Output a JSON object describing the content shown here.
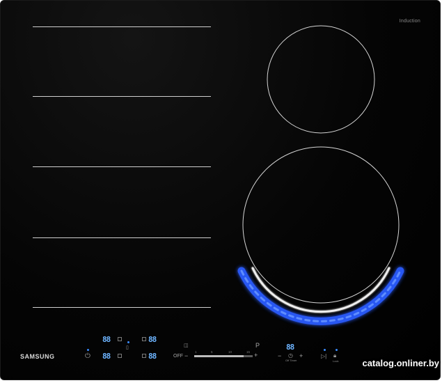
{
  "brand_tag": "Induction",
  "logo": "SAMSUNG",
  "zones": {
    "left_lines": 5
  },
  "displays": {
    "zone_a": "88",
    "zone_b": "88",
    "zone_c": "88",
    "zone_d": "88",
    "timer": "88"
  },
  "controls": {
    "off_label": "OFF",
    "minus_label": "−",
    "plus_label": "+",
    "power_label": "P",
    "timer_minus": "−",
    "timer_plus": "+",
    "timer_caption": "Off Timer",
    "lock_caption": "Lock",
    "slider_ticks": [
      "1",
      "5",
      "10",
      "15"
    ],
    "slider_level": 0.85
  },
  "accent_color": "#2f6bff",
  "ring_color": "#e8e8e8",
  "watermark": "catalog.onliner.by"
}
